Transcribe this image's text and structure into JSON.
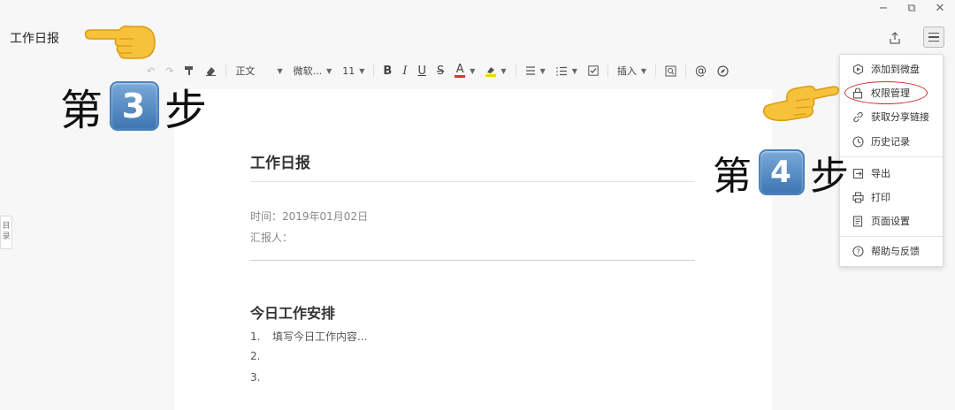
{
  "window": {
    "minimize": "−",
    "restore": "⧉",
    "close": "✕"
  },
  "header": {
    "title": "工作日报"
  },
  "toolbar": {
    "paragraph_style": "正文",
    "font_family": "微软...",
    "font_size": "11",
    "bold": "B",
    "italic": "I",
    "underline": "U",
    "strike": "S",
    "font_color": "A",
    "insert": "插入"
  },
  "document": {
    "title": "工作日报",
    "time_line": "时间：2019年01月02日",
    "reporter_line": "汇报人：",
    "section_heading": "今日工作安排",
    "list": [
      {
        "num": "1.",
        "text": "填写今日工作内容..."
      },
      {
        "num": "2.",
        "text": ""
      },
      {
        "num": "3.",
        "text": ""
      }
    ],
    "toc_tab": "目录"
  },
  "menu": {
    "items": [
      {
        "label": "添加到微盘",
        "icon": "cube-icon"
      },
      {
        "label": "权限管理",
        "icon": "lock-icon"
      },
      {
        "label": "获取分享链接",
        "icon": "link-icon"
      },
      {
        "label": "历史记录",
        "icon": "clock-icon"
      },
      {
        "label": "导出",
        "icon": "export-icon"
      },
      {
        "label": "打印",
        "icon": "printer-icon"
      },
      {
        "label": "页面设置",
        "icon": "page-icon"
      },
      {
        "label": "帮助与反馈",
        "icon": "help-icon"
      }
    ]
  },
  "annotations": {
    "step3": {
      "prefix": "第",
      "number": "3",
      "suffix": "步"
    },
    "step4": {
      "prefix": "第",
      "number": "4",
      "suffix": "步"
    }
  },
  "colors": {
    "highlight_ring": "#d7262b",
    "badge": "#3d76b4",
    "font_color_bar": "#e0332f",
    "highlight_bar": "#f2d600"
  }
}
